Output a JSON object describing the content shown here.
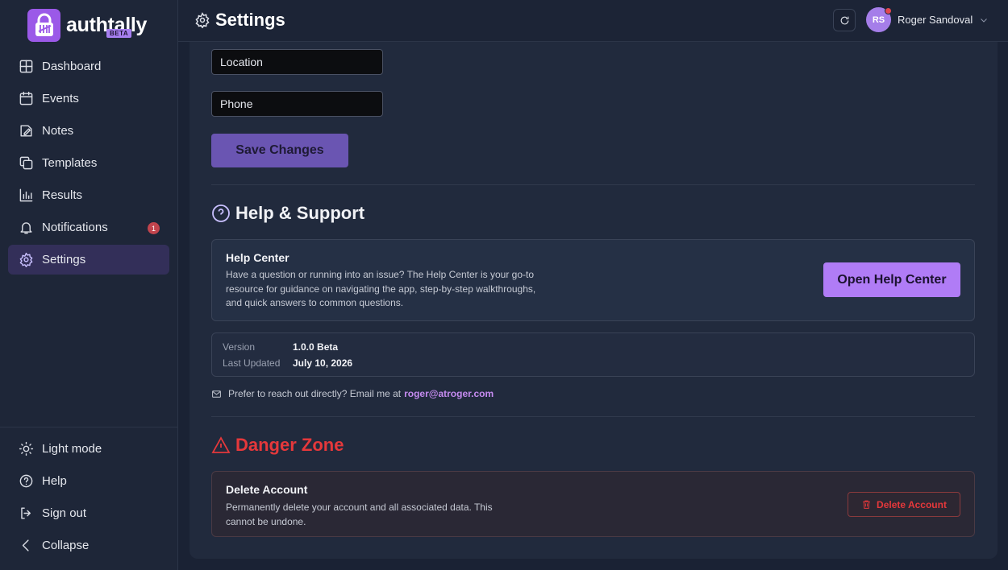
{
  "brand": {
    "name": "authtally",
    "badge": "BETA"
  },
  "sidebar": {
    "items": [
      {
        "label": "Dashboard",
        "icon": "dashboard-icon"
      },
      {
        "label": "Events",
        "icon": "calendar-icon"
      },
      {
        "label": "Notes",
        "icon": "notes-icon"
      },
      {
        "label": "Templates",
        "icon": "templates-icon"
      },
      {
        "label": "Results",
        "icon": "chart-icon"
      },
      {
        "label": "Notifications",
        "icon": "bell-icon",
        "badge": "1"
      },
      {
        "label": "Settings",
        "icon": "gear-icon",
        "active": true
      }
    ],
    "bottom": [
      {
        "label": "Light mode",
        "icon": "sun-icon"
      },
      {
        "label": "Help",
        "icon": "help-icon"
      },
      {
        "label": "Sign out",
        "icon": "sign-out-icon"
      },
      {
        "label": "Collapse",
        "icon": "chevron-left-icon"
      }
    ]
  },
  "header": {
    "title": "Settings",
    "user": {
      "initials": "RS",
      "name": "Roger Sandoval"
    }
  },
  "profile_form": {
    "location_placeholder": "Location",
    "phone_placeholder": "Phone",
    "save_label": "Save Changes"
  },
  "help": {
    "title": "Help & Support",
    "center_title": "Help Center",
    "center_text": "Have a question or running into an issue? The Help Center is your go-to resource for guidance on navigating the app, step-by-step walkthroughs, and quick answers to common questions.",
    "button_label": "Open Help Center",
    "version_label": "Version",
    "version_value": "1.0.0 Beta",
    "updated_label": "Last Updated",
    "updated_value": "July 10, 2026",
    "contact_text": "Prefer to reach out directly? Email me at",
    "contact_email": "roger@atroger.com"
  },
  "danger": {
    "title": "Danger Zone",
    "delete_title": "Delete Account",
    "delete_text": "Permanently delete your account and all associated data. This cannot be undone.",
    "button_label": "Delete Account"
  },
  "colors": {
    "accent": "#b07cf6",
    "danger": "#e5383b",
    "background": "#1a2234"
  }
}
